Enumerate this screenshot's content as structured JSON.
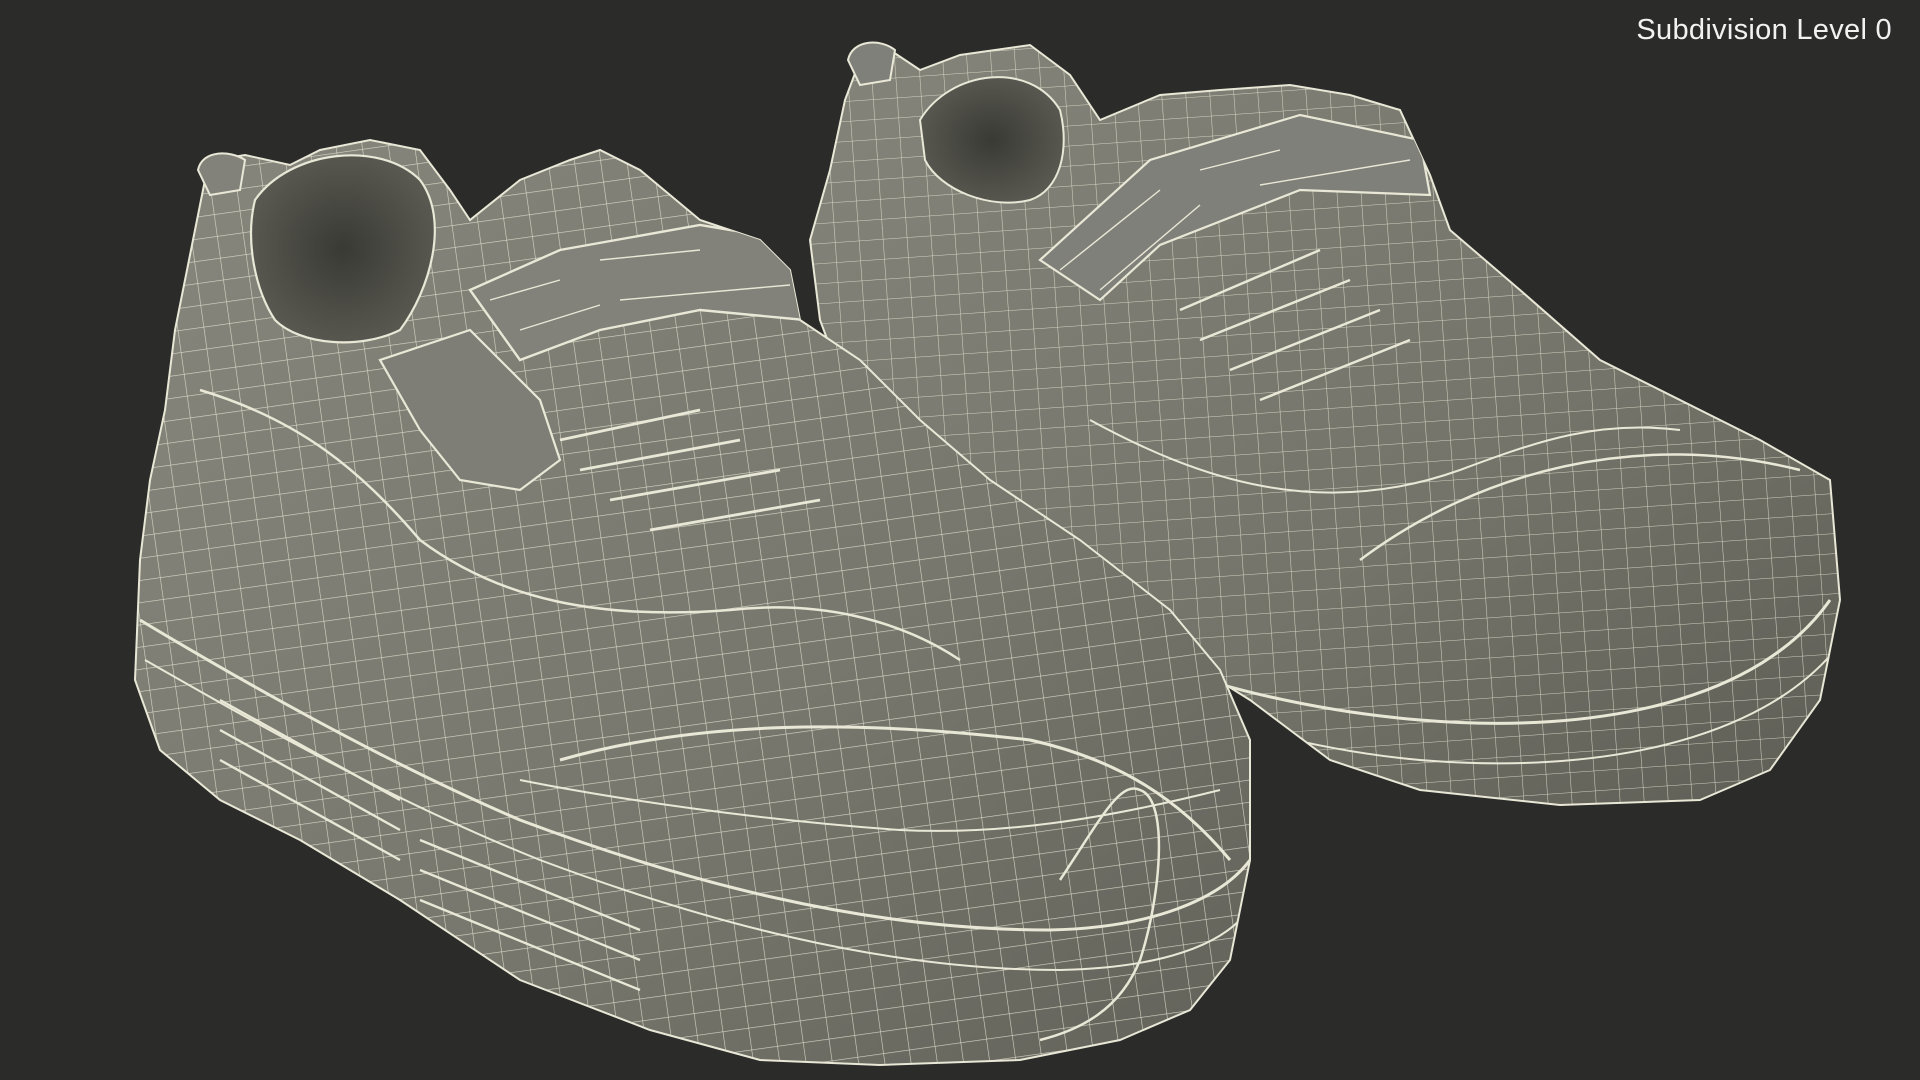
{
  "overlay": {
    "subdivision_label": "Subdivision Level 0"
  },
  "colors": {
    "background": "#2b2b2a",
    "mesh_fill": "#7a7a70",
    "mesh_shadow": "#55554d",
    "wireframe": "#e9e7d6",
    "label_text": "#f2f2f2"
  },
  "scene": {
    "subject": "pair-of-sneakers-wireframe",
    "shoe_count": 2
  }
}
